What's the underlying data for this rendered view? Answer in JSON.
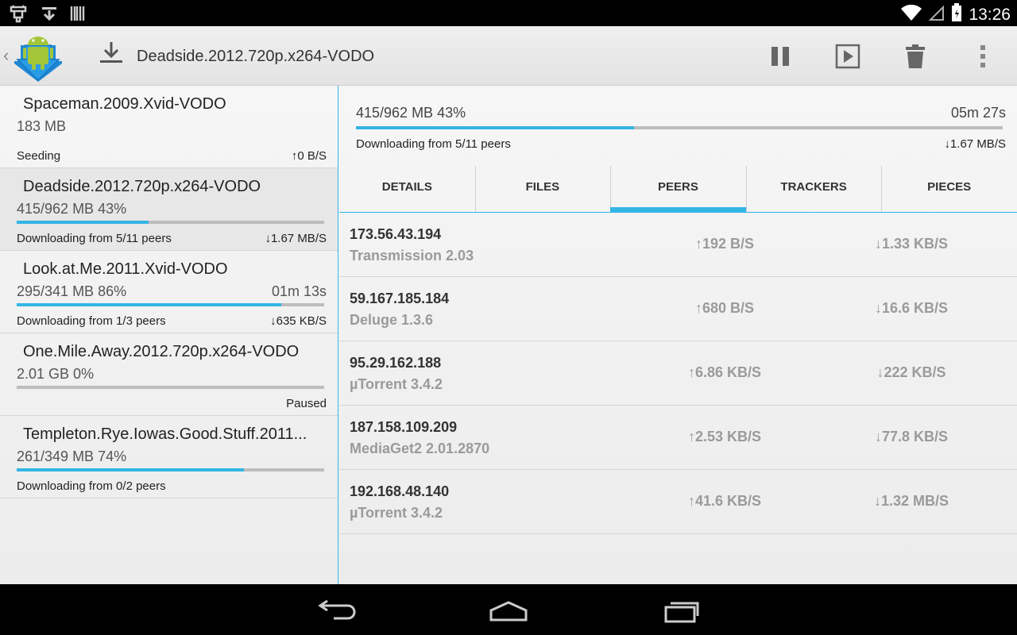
{
  "status_bar": {
    "time": "13:26",
    "icons_left": [
      "usb-debug-icon",
      "download-notification-icon",
      "barcode-icon"
    ],
    "icons_right": [
      "wifi-icon",
      "signal-icon",
      "battery-icon"
    ]
  },
  "action_bar": {
    "title": "Deadside.2012.720p.x264-VODO",
    "actions": [
      "pause-icon",
      "play-icon",
      "trash-icon",
      "overflow-menu-icon"
    ]
  },
  "torrents": [
    {
      "name": "Spaceman.2009.Xvid-VODO",
      "size": "183 MB",
      "eta": "",
      "progress": null,
      "status": "Seeding",
      "rate": "↑0 B/S"
    },
    {
      "name": "Deadside.2012.720p.x264-VODO",
      "size": "415/962 MB   43%",
      "eta": "",
      "progress": 0.43,
      "status": "Downloading from 5/11 peers",
      "rate": "↓1.67 MB/S"
    },
    {
      "name": "Look.at.Me.2011.Xvid-VODO",
      "size": "295/341 MB   86%",
      "eta": "01m 13s",
      "progress": 0.86,
      "status": "Downloading from 1/3 peers",
      "rate": "↓635 KB/S"
    },
    {
      "name": "One.Mile.Away.2012.720p.x264-VODO",
      "size": "2.01 GB   0%",
      "eta": "",
      "progress": 0.0,
      "status": "",
      "rate": "Paused"
    },
    {
      "name": "Templeton.Rye.Iowas.Good.Stuff.2011...",
      "size": "261/349 MB   74%",
      "eta": "",
      "progress": 0.74,
      "status": "Downloading from 0/2 peers",
      "rate": ""
    }
  ],
  "detail": {
    "size": "415/962 MB   43%",
    "eta": "05m 27s",
    "progress": 0.43,
    "status": "Downloading from 5/11 peers",
    "rate": "↓1.67 MB/S"
  },
  "tabs": [
    {
      "label": "DETAILS",
      "active": false
    },
    {
      "label": "FILES",
      "active": false
    },
    {
      "label": "PEERS",
      "active": true
    },
    {
      "label": "TRACKERS",
      "active": false
    },
    {
      "label": "PIECES",
      "active": false
    }
  ],
  "peers": [
    {
      "ip": "173.56.43.194",
      "client": "Transmission 2.03",
      "up": "↑192 B/S",
      "down": "↓1.33 KB/S"
    },
    {
      "ip": "59.167.185.184",
      "client": "Deluge 1.3.6",
      "up": "↑680 B/S",
      "down": "↓16.6 KB/S"
    },
    {
      "ip": "95.29.162.188",
      "client": "µTorrent 3.4.2",
      "up": "↑6.86 KB/S",
      "down": "↓222 KB/S"
    },
    {
      "ip": "187.158.109.209",
      "client": "MediaGet2 2.01.2870",
      "up": "↑2.53 KB/S",
      "down": "↓77.8 KB/S"
    },
    {
      "ip": "192.168.48.140",
      "client": "µTorrent 3.4.2",
      "up": "↑41.6 KB/S",
      "down": "↓1.32 MB/S"
    }
  ],
  "colors": {
    "accent": "#33b5e5",
    "progress_track": "#bdbdbd"
  }
}
